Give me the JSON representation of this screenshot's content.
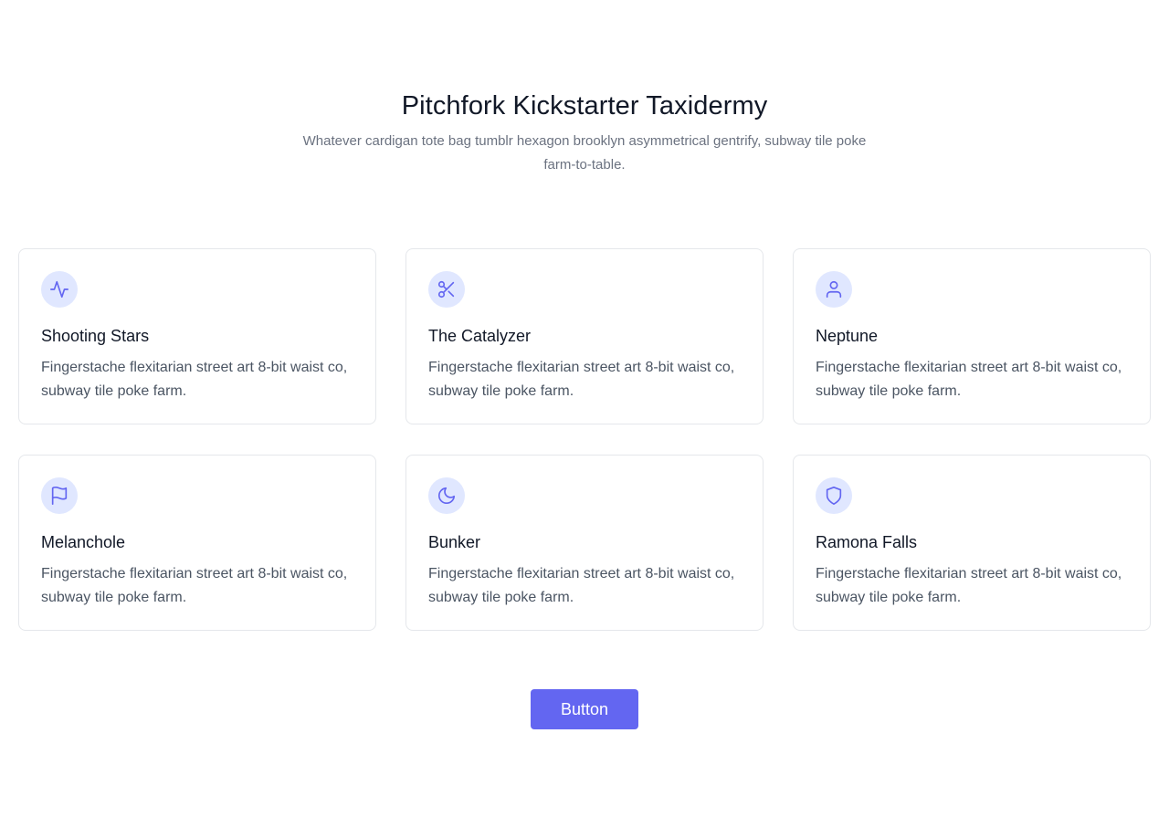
{
  "header": {
    "title": "Pitchfork Kickstarter Taxidermy",
    "subtitle": "Whatever cardigan tote bag tumblr hexagon brooklyn asymmetrical gentrify, subway tile poke farm-to-table."
  },
  "colors": {
    "accent": "#6366f1",
    "icon_bg": "#e0e7ff",
    "title": "#111827",
    "body_text": "#4b5563",
    "muted_text": "#6b7280",
    "card_border": "#e5e7eb"
  },
  "cards": [
    {
      "icon": "pulse-icon",
      "title": "Shooting Stars",
      "text": "Fingerstache flexitarian street art 8-bit waist co, subway tile poke farm."
    },
    {
      "icon": "scissors-icon",
      "title": "The Catalyzer",
      "text": "Fingerstache flexitarian street art 8-bit waist co, subway tile poke farm."
    },
    {
      "icon": "user-icon",
      "title": "Neptune",
      "text": "Fingerstache flexitarian street art 8-bit waist co, subway tile poke farm."
    },
    {
      "icon": "flag-icon",
      "title": "Melanchole",
      "text": "Fingerstache flexitarian street art 8-bit waist co, subway tile poke farm."
    },
    {
      "icon": "moon-icon",
      "title": "Bunker",
      "text": "Fingerstache flexitarian street art 8-bit waist co, subway tile poke farm."
    },
    {
      "icon": "shield-icon",
      "title": "Ramona Falls",
      "text": "Fingerstache flexitarian street art 8-bit waist co, subway tile poke farm."
    }
  ],
  "cta": {
    "label": "Button"
  }
}
